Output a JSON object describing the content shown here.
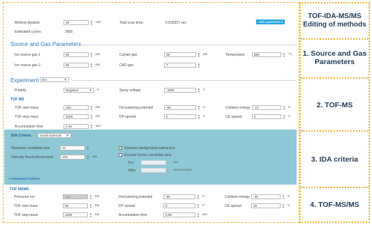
{
  "sidebar": {
    "title": "TOF-IDA-MS/MS Editing of methods",
    "sections": [
      {
        "label": "1. Source and Gas Parameters"
      },
      {
        "label": "2. TOF-MS"
      },
      {
        "label": "3. IDA criteria"
      },
      {
        "label": "4. TOF-MS/MS"
      }
    ]
  },
  "method": {
    "duration_label": "Method duration",
    "duration_value": "30",
    "duration_unit": "min",
    "total_scan_label": "Total scan time:",
    "total_scan_value": "0.818307 sec",
    "cycles_label": "Estimated cycles:",
    "cycles_value": "3656",
    "add_experiment": "Add experiment"
  },
  "source": {
    "title": "Source and Gas Parameters",
    "ion_gas1_label": "Ion source gas 1",
    "ion_gas1_value": "55",
    "ion_gas2_label": "Ion source gas 2",
    "ion_gas2_value": "55",
    "curtain_label": "Curtain gas",
    "curtain_value": "35",
    "cad_label": "CAD gas",
    "cad_value": "7",
    "temp_label": "Temperature",
    "temp_value": "550",
    "unit_psi": "psi",
    "unit_c": "°C"
  },
  "experiment": {
    "title": "Experiment",
    "select_value": "IDA",
    "polarity_label": "Polarity",
    "polarity_value": "Negative",
    "unit_v": "V",
    "spray_label": "Spray voltage",
    "spray_value": "-4500"
  },
  "tofms": {
    "title": "TOF MS",
    "start_label": "TOF start mass",
    "start_value": "100",
    "stop_label": "TOF stop mass",
    "stop_value": "1000",
    "accum_label": "Accumulation time",
    "accum_value": "0.15",
    "unit_da": "Da",
    "unit_sec": "sec",
    "dp_label": "Declustering potential",
    "dp_value": "-80",
    "dps_label": "DP spread",
    "dps_value": "0",
    "ce_label": "Collision energy",
    "ce_value": "-10",
    "ces_label": "CE spread",
    "ces_value": "0"
  },
  "ida": {
    "title": "IDA Criteria",
    "select_value": "Small molecule",
    "max_label": "Maximum candidate ions",
    "max_value": "12",
    "thresh_label": "Intensity threshold exceeds",
    "thresh_value": "100",
    "unit_cps": "cps",
    "dynamic_label": "Dynamic background subtraction",
    "dynamic_check": "✓",
    "exclude_label": "Exclude former candidate ions",
    "for_label": "For",
    "for_unit": "sec",
    "after_label": "After",
    "after_unit": "occurrences",
    "advanced": "+ Advanced Criteria"
  },
  "tofmsms": {
    "title": "TOF MSMS",
    "precursor_label": "Precursor ion",
    "precursor_value": "100",
    "start_label": "TOF start mass",
    "start_value": "50",
    "stop_label": "TOF stop mass",
    "stop_value": "1000",
    "unit_da": "Da",
    "dp_label": "Declustering potential",
    "dp_value": "-80",
    "dps_label": "DP spread",
    "dps_value": "0",
    "accum_label": "Accumulation time",
    "accum_value": "0.05",
    "unit_v": "V",
    "unit_sec": "sec",
    "ce_label": "Collision energy",
    "ce_value": "-40",
    "ces_label": "CE spread",
    "ces_value": "20"
  },
  "colors": {
    "accent_border": "#f0b429",
    "section_blue": "#2a7ab8",
    "ida_background": "#8fc7d6",
    "button_blue": "#2aa5dc"
  }
}
